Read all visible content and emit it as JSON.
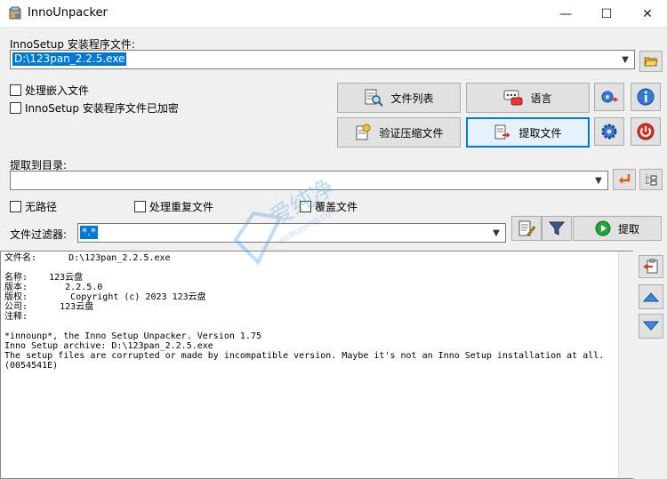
{
  "window": {
    "title": "InnoUnpacker",
    "minimize": "—",
    "maximize": "☐",
    "close": "✕"
  },
  "setup_file": {
    "label": "InnoSetup 安装程序文件:",
    "value": "D:\\123pan_2.2.5.exe"
  },
  "options": {
    "process_embedded": "处理嵌入文件",
    "encrypted": "InnoSetup 安装程序文件已加密"
  },
  "buttons": {
    "file_list": "文件列表",
    "language": "语言",
    "verify": "验证压缩文件",
    "extract_files": "提取文件",
    "extract": "提取"
  },
  "extract_dir": {
    "label": "提取到目录:",
    "value": ""
  },
  "extract_options": {
    "no_path": "无路径",
    "duplicates": "处理重复文件",
    "overwrite": "覆盖文件"
  },
  "filter": {
    "label": "文件过滤器:",
    "value": "*.*"
  },
  "log": {
    "lines": [
      "文件名:      D:\\123pan_2.2.5.exe",
      "",
      "名称:    123云盘",
      "版本:       2.2.5.0",
      "版权:        Copyright (c) 2023 123云盘",
      "公司:      123云盘",
      "注释:",
      "",
      "*innounp*, the Inno Setup Unpacker. Version 1.75",
      "Inno Setup archive: D:\\123pan_2.2.5.exe",
      "The setup files are corrupted or made by incompatible version. Maybe it's not an Inno Setup installation at all.",
      "(0054541E)"
    ]
  },
  "watermark": {
    "text": "爱纯净",
    "url": "aichunjing.com"
  },
  "colors": {
    "selection": "#0078d7",
    "accent_blue": "#3a7bd5",
    "power_red": "#d9342b",
    "go_green": "#22a53a"
  }
}
